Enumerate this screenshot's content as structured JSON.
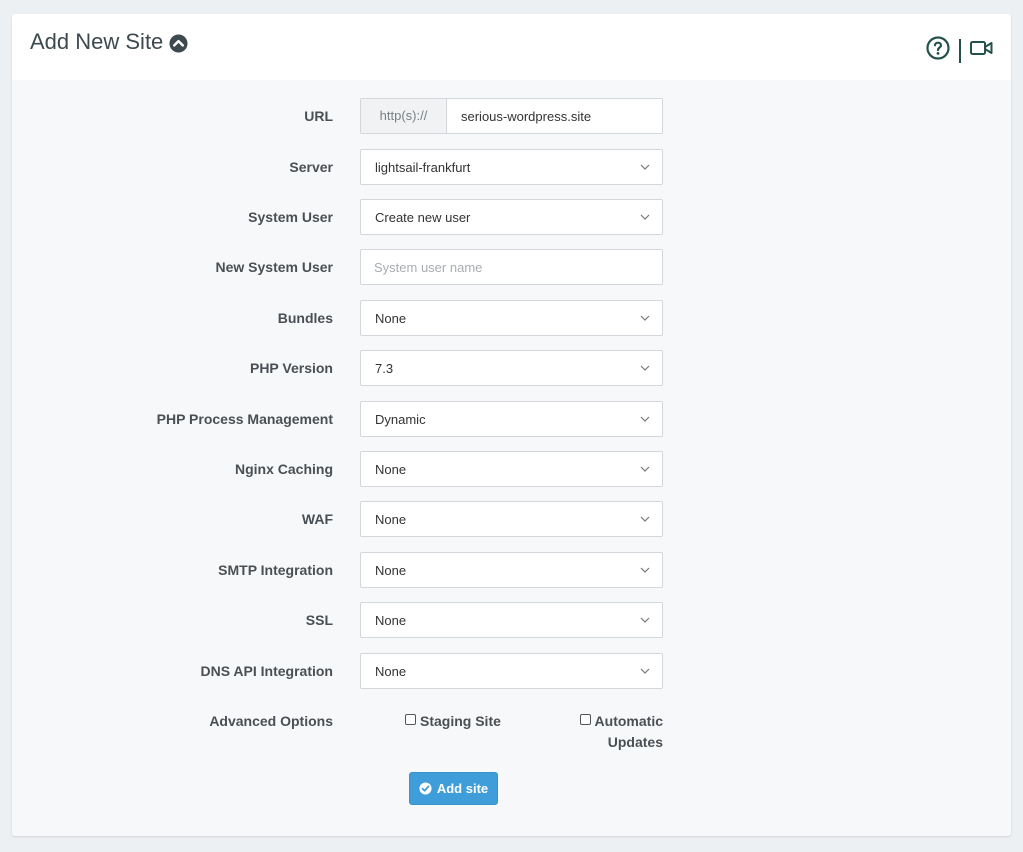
{
  "header": {
    "title": "Add New Site",
    "icons": [
      "chevron-up-circle-icon",
      "help-circle-icon",
      "video-camera-icon"
    ]
  },
  "form": {
    "url": {
      "label": "URL",
      "prefix": "http(s)://",
      "value": "serious-wordpress.site"
    },
    "server": {
      "label": "Server",
      "value": "lightsail-frankfurt"
    },
    "system_user": {
      "label": "System User",
      "value": "Create new user"
    },
    "new_system_user": {
      "label": "New System User",
      "placeholder": "System user name"
    },
    "bundles": {
      "label": "Bundles",
      "value": "None"
    },
    "php_version": {
      "label": "PHP Version",
      "value": "7.3"
    },
    "php_process": {
      "label": "PHP Process Management",
      "value": "Dynamic"
    },
    "nginx_caching": {
      "label": "Nginx Caching",
      "value": "None"
    },
    "waf": {
      "label": "WAF",
      "value": "None"
    },
    "smtp": {
      "label": "SMTP Integration",
      "value": "None"
    },
    "ssl": {
      "label": "SSL",
      "value": "None"
    },
    "dns_api": {
      "label": "DNS API Integration",
      "value": "None"
    },
    "advanced": {
      "label": "Advanced Options",
      "staging_label": "Staging Site",
      "auto_updates_line1": "Automatic",
      "auto_updates_line2": "Updates"
    },
    "submit_label": "Add site"
  },
  "colors": {
    "accent": "#3f9ed9",
    "icon": "#24524a",
    "background": "#edf0f3"
  }
}
